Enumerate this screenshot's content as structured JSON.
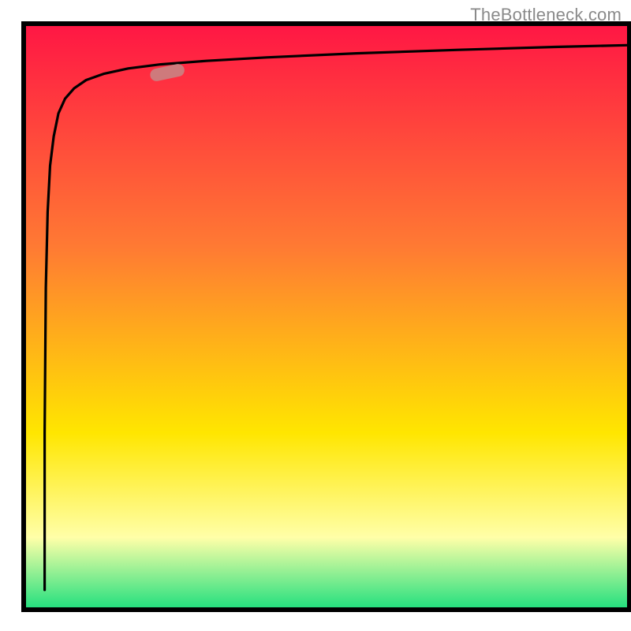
{
  "watermark": "TheBottleneck.com",
  "chart_data": {
    "type": "line",
    "title": "",
    "xlabel": "",
    "ylabel": "",
    "xlim": [
      0,
      100
    ],
    "ylim": [
      0,
      100
    ],
    "grid": false,
    "legend": false,
    "background_gradient": {
      "top": "#ff1744",
      "mid_upper": "#ff7a33",
      "mid": "#ffe600",
      "mid_lower": "#ffffa8",
      "bottom": "#26e07f"
    },
    "axis_color": "#000000",
    "series": [
      {
        "name": "curve",
        "color": "#000000",
        "x": [
          3.1,
          3.1,
          3.3,
          3.6,
          4.0,
          4.6,
          5.4,
          6.5,
          8.0,
          10.0,
          13.0,
          17.0,
          22.4,
          30.0,
          40.0,
          55.0,
          72.0,
          88.0,
          100.0
        ],
        "y": [
          3.0,
          30.0,
          55.0,
          68.0,
          76.0,
          81.0,
          85.0,
          87.5,
          89.3,
          90.7,
          91.8,
          92.7,
          93.4,
          94.0,
          94.6,
          95.3,
          95.9,
          96.4,
          96.7
        ]
      }
    ],
    "marker": {
      "name": "highlight",
      "x": 23.5,
      "y": 92.0,
      "rotation_deg": -12,
      "fill": "#c98383",
      "opacity": 0.9
    }
  }
}
